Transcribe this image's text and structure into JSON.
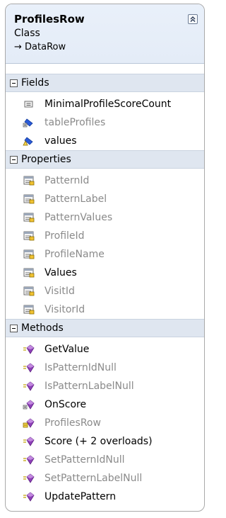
{
  "class": {
    "name": "ProfilesRow",
    "kind": "Class",
    "base": "→ DataRow"
  },
  "sections": {
    "fields": {
      "label": "Fields",
      "items": [
        {
          "label": "MinimalProfileScoreCount",
          "icon": "constant-field-icon",
          "private": false
        },
        {
          "label": "tableProfiles",
          "icon": "private-field-icon",
          "private": true
        },
        {
          "label": "values",
          "icon": "protected-field-icon",
          "private": false
        }
      ]
    },
    "properties": {
      "label": "Properties",
      "items": [
        {
          "label": "PatternId",
          "icon": "property-icon",
          "private": true
        },
        {
          "label": "PatternLabel",
          "icon": "property-icon",
          "private": true
        },
        {
          "label": "PatternValues",
          "icon": "property-icon",
          "private": true
        },
        {
          "label": "ProfileId",
          "icon": "property-icon",
          "private": true
        },
        {
          "label": "ProfileName",
          "icon": "property-icon",
          "private": true
        },
        {
          "label": "Values",
          "icon": "property-icon",
          "private": false
        },
        {
          "label": "VisitId",
          "icon": "property-icon",
          "private": true
        },
        {
          "label": "VisitorId",
          "icon": "property-icon",
          "private": true
        }
      ]
    },
    "methods": {
      "label": "Methods",
      "items": [
        {
          "label": "GetValue",
          "icon": "method-icon",
          "private": false
        },
        {
          "label": "IsPatternIdNull",
          "icon": "method-icon",
          "private": true
        },
        {
          "label": "IsPatternLabelNull",
          "icon": "method-icon",
          "private": true
        },
        {
          "label": "OnScore",
          "icon": "protected-method-icon",
          "private": false
        },
        {
          "label": "ProfilesRow",
          "icon": "internal-method-icon",
          "private": true
        },
        {
          "label": "Score (+ 2 overloads)",
          "icon": "method-icon",
          "private": false
        },
        {
          "label": "SetPatternIdNull",
          "icon": "method-icon",
          "private": true
        },
        {
          "label": "SetPatternLabelNull",
          "icon": "method-icon",
          "private": true
        },
        {
          "label": "UpdatePattern",
          "icon": "method-icon",
          "private": false
        }
      ]
    }
  },
  "colors": {
    "header_bg": "#e4ecf7",
    "section_bg": "#dfe6f0",
    "border": "#a9a9a9",
    "private_text": "#8a8a8a",
    "method_purple": "#8e3fb8",
    "field_blue": "#1a4fd1"
  }
}
